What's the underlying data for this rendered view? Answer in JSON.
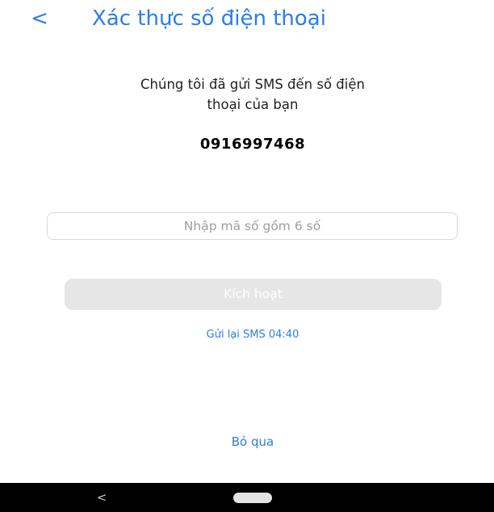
{
  "header": {
    "back_glyph": "<",
    "title": "Xác thực số điện thoại"
  },
  "message": {
    "line1": "Chúng tôi đã gửi SMS đến số điện",
    "line2": "thoại của bạn"
  },
  "phone_number": "0916997468",
  "code_input": {
    "placeholder": "Nhập mã số gồm 6 số",
    "value": ""
  },
  "activate_button": {
    "label": "Kích hoạt"
  },
  "resend": {
    "label": "Gửi lại SMS 04:40"
  },
  "skip": {
    "label": "Bỏ qua"
  },
  "nav_bar": {
    "back_glyph": "<"
  },
  "colors": {
    "accent": "#2b7de9",
    "button_disabled": "#e6e6e6",
    "nav_background": "#000000"
  },
  "icons": {
    "back": "chevron-left-icon",
    "nav_back": "nav-back-icon",
    "nav_home": "nav-home-pill-icon"
  }
}
